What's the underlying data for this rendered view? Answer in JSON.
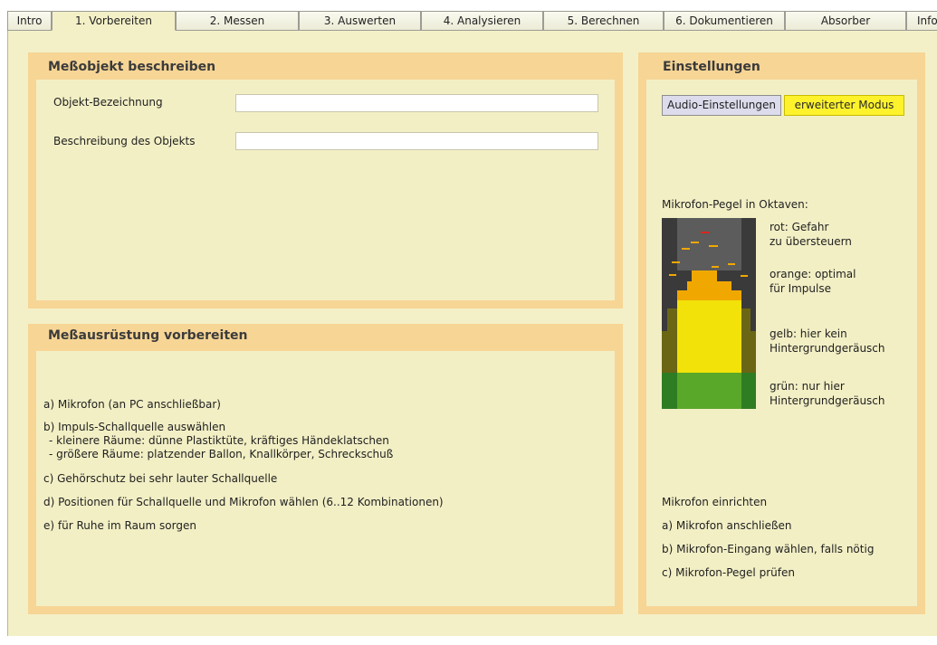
{
  "tabs": [
    {
      "label": "Intro"
    },
    {
      "label": "1. Vorbereiten"
    },
    {
      "label": "2. Messen"
    },
    {
      "label": "3. Auswerten"
    },
    {
      "label": "4. Analysieren"
    },
    {
      "label": "5. Berechnen"
    },
    {
      "label": "6. Dokumentieren"
    },
    {
      "label": "Absorber"
    },
    {
      "label": "Info"
    }
  ],
  "active_tab": "1. Vorbereiten",
  "object_panel": {
    "title": "Meßobjekt beschreiben",
    "name_label": "Objekt-Bezeichnung",
    "name_value": "",
    "desc_label": "Beschreibung des Objekts",
    "desc_value": ""
  },
  "equipment_panel": {
    "title": "Meßausrüstung vorbereiten",
    "items": [
      "a) Mikrofon (an PC anschließbar)",
      "b) Impuls-Schallquelle auswählen",
      "- kleinere Räume: dünne Plastiktüte, kräftiges Händeklatschen",
      "- größere Räume: platzender Ballon, Knallkörper, Schreckschuß",
      "c) Gehörschutz bei sehr lauter Schallquelle",
      "d) Positionen für Schallquelle und Mikrofon wählen (6..12 Kombinationen)",
      "e) für Ruhe im Raum sorgen"
    ]
  },
  "settings_panel": {
    "title": "Einstellungen",
    "audio_button": "Audio-Einstellungen",
    "mode_button": "erweiterter Modus",
    "meter_title": "Mikrofon-Pegel in Oktaven:",
    "legend": {
      "red_1": "rot: Gefahr",
      "red_2": "zu übersteuern",
      "orange_1": "orange: optimal",
      "orange_2": "für Impulse",
      "yellow_1": "gelb: hier kein",
      "yellow_2": "Hintergrundgeräusch",
      "green_1": "grün: nur hier",
      "green_2": "Hintergrundgeräusch"
    },
    "setup_title": "Mikrofon einrichten",
    "setup_steps": [
      "a) Mikrofon anschließen",
      "b) Mikrofon-Eingang wählen, falls nötig",
      "c) Mikrofon-Pegel prüfen"
    ]
  },
  "colors": {
    "background": "#f3f0c7",
    "panel_header": "#f7d595",
    "accent_yellow": "#fdf22c",
    "meter_red": "#d8261c",
    "meter_orange": "#f0a800",
    "meter_yellow": "#f2e20a",
    "meter_green": "#5aa82a"
  }
}
